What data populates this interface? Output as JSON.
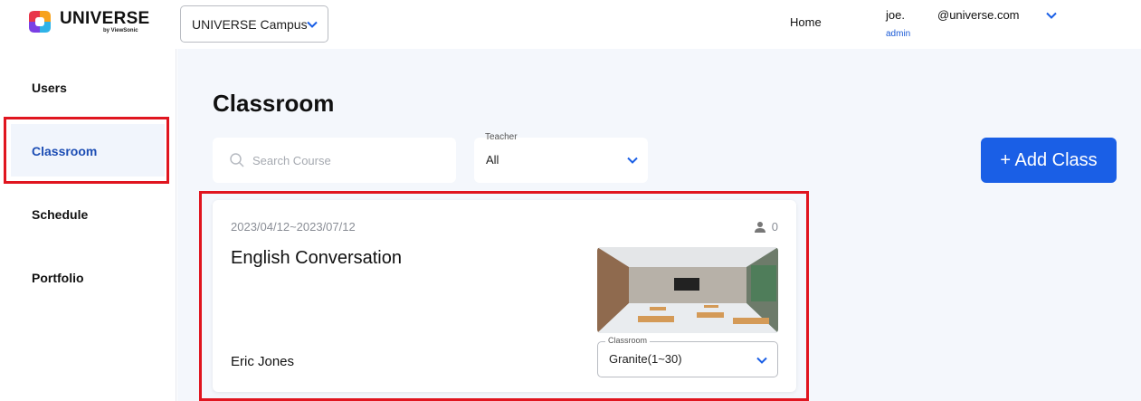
{
  "brand": {
    "name": "UNIVERSE",
    "byline": "by ViewSonic"
  },
  "header": {
    "campus": "UNIVERSE Campus",
    "home": "Home",
    "user_name": "joe.",
    "user_email": "@universe.com",
    "user_role": "admin"
  },
  "sidebar": {
    "items": [
      {
        "label": "Users"
      },
      {
        "label": "Classroom",
        "active": true
      },
      {
        "label": "Schedule"
      },
      {
        "label": "Portfolio"
      }
    ]
  },
  "main": {
    "title": "Classroom",
    "search_placeholder": "Search Course",
    "teacher_filter": {
      "label": "Teacher",
      "value": "All"
    },
    "add_button": "+ Add Class"
  },
  "classes": [
    {
      "dates": "2023/04/12~2023/07/12",
      "students": "0",
      "title": "English Conversation",
      "teacher": "Eric Jones",
      "classroom_label": "Classroom",
      "classroom": "Granite(1~30)"
    }
  ],
  "colors": {
    "accent": "#1a5fe6",
    "highlight": "#e0151f",
    "active_nav": "#1c4db4"
  }
}
